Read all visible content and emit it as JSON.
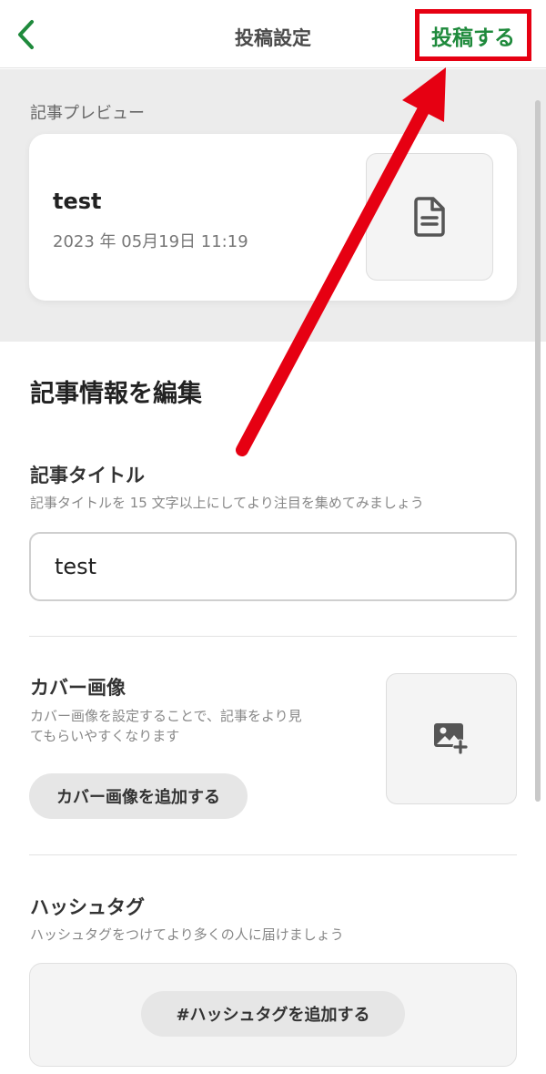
{
  "header": {
    "title": "投稿設定",
    "post_label": "投稿する"
  },
  "preview": {
    "section_label": "記事プレビュー",
    "article_title": "test",
    "date": "2023 年 05月19日 11:19"
  },
  "edit": {
    "heading": "記事情報を編集",
    "title_field": {
      "label": "記事タイトル",
      "help": "記事タイトルを 15 文字以上にしてより注目を集めてみましょう",
      "value": "test"
    },
    "cover": {
      "label": "カバー画像",
      "help_line1": "カバー画像を設定することで、記事をより見",
      "help_line2": "てもらいやすくなります",
      "button_label": "カバー画像を追加する"
    },
    "hashtag": {
      "label": "ハッシュタグ",
      "help": "ハッシュタグをつけてより多くの人に届けましょう",
      "button_label": "#ハッシュタグを追加する"
    }
  },
  "icons": {
    "back": "chevron-left-icon",
    "document": "document-icon",
    "add_image": "image-add-icon"
  },
  "colors": {
    "accent_green": "#1f8a3c",
    "highlight_red": "#e60012"
  }
}
